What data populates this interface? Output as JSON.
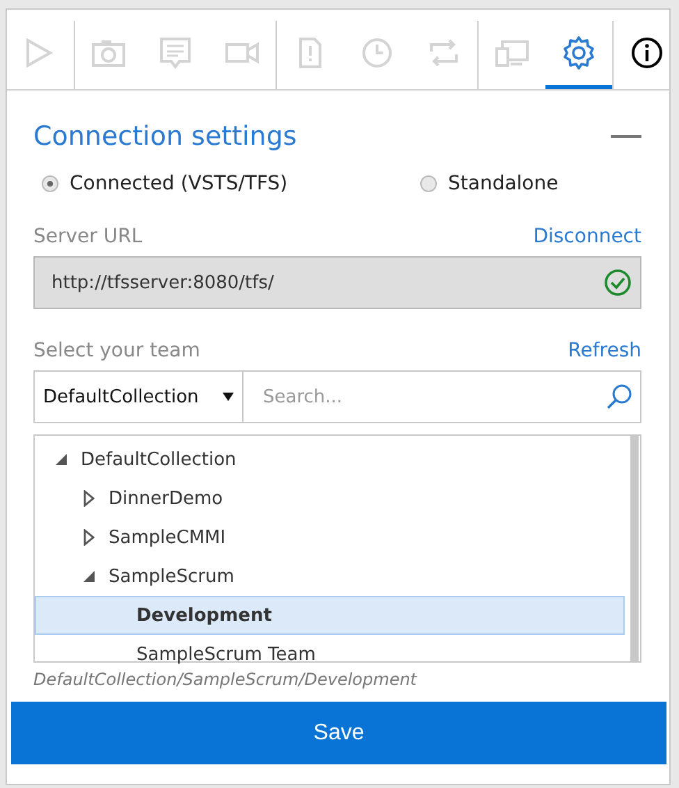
{
  "toolbar": {
    "groups": [
      [
        {
          "kind": "play",
          "disabled": true,
          "selected": false
        }
      ],
      [
        {
          "kind": "camera",
          "disabled": true,
          "selected": false
        },
        {
          "kind": "note",
          "disabled": true,
          "selected": false
        },
        {
          "kind": "video",
          "disabled": true,
          "selected": false
        }
      ],
      [
        {
          "kind": "file",
          "disabled": true,
          "selected": false
        },
        {
          "kind": "clock",
          "disabled": true,
          "selected": false
        },
        {
          "kind": "loop",
          "disabled": true,
          "selected": false
        }
      ],
      [
        {
          "kind": "devices",
          "disabled": true,
          "selected": false
        },
        {
          "kind": "settings",
          "disabled": false,
          "selected": true
        }
      ],
      [
        {
          "kind": "info",
          "disabled": false,
          "selected": false
        }
      ]
    ]
  },
  "section": {
    "title": "Connection settings",
    "expanded": true
  },
  "modes": [
    {
      "label": "Connected (VSTS/TFS)",
      "selected": true
    },
    {
      "label": "Standalone",
      "selected": false
    }
  ],
  "server": {
    "label": "Server URL",
    "action": "Disconnect",
    "value": "http://tfsserver:8080/tfs/",
    "verified": true
  },
  "team": {
    "label": "Select your team",
    "action": "Refresh",
    "collection": "DefaultCollection",
    "search": {
      "placeholder": "Search..."
    },
    "tree": [
      {
        "label": "DefaultCollection",
        "expanded": true,
        "selected": false,
        "children": [
          {
            "label": "DinnerDemo",
            "expanded": false,
            "selected": false
          },
          {
            "label": "SampleCMMI",
            "expanded": false,
            "selected": false
          },
          {
            "label": "SampleScrum",
            "expanded": true,
            "selected": false,
            "children": [
              {
                "label": "Development",
                "selected": true
              },
              {
                "label": "SampleScrum Team",
                "selected": false
              }
            ]
          }
        ]
      }
    ],
    "path": "DefaultCollection/SampleScrum/Development"
  },
  "buttons": [
    {
      "label": "Save"
    }
  ]
}
